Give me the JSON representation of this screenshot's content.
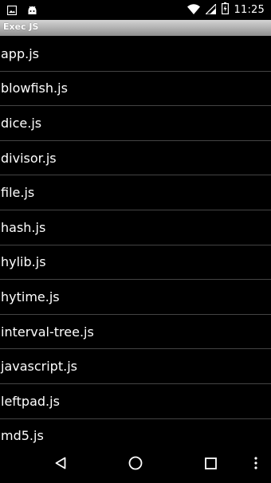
{
  "status_bar": {
    "time": "11:25",
    "icons": [
      "image-icon",
      "android-icon",
      "wifi-icon",
      "signal-icon",
      "battery-icon"
    ]
  },
  "app": {
    "title": "Exec JS"
  },
  "files": [
    "app.js",
    "blowfish.js",
    "dice.js",
    "divisor.js",
    "file.js",
    "hash.js",
    "hylib.js",
    "hytime.js",
    "interval-tree.js",
    "javascript.js",
    "leftpad.js",
    "md5.js"
  ],
  "nav_bar": {
    "icons": [
      "back-icon",
      "home-icon",
      "recents-icon",
      "more-icon"
    ]
  },
  "colors": {
    "background": "#000000",
    "text": "#ffffff",
    "divider": "#444444",
    "title_bar_top": "#d4d4d4",
    "title_bar_bottom": "#8f8f8f"
  }
}
